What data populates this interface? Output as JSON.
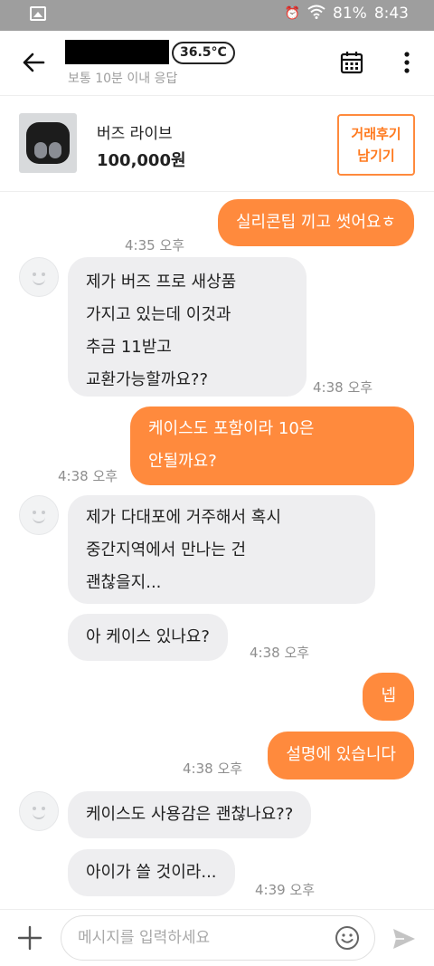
{
  "status_bar": {
    "battery": "81%",
    "time": "8:43"
  },
  "header": {
    "temperature": "36.5°C",
    "response_time": "보통 10분 이내 응답"
  },
  "product": {
    "name": "버즈 라이브",
    "price": "100,000원",
    "review_button": [
      "거래후기",
      "남기기"
    ]
  },
  "messages": [
    {
      "sender": "me",
      "lines": [
        "실리콘팁 끼고 썻어요ㅎ"
      ],
      "time": "4:35 오후"
    },
    {
      "sender": "them",
      "lines": [
        "제가 버즈 프로 새상품",
        "가지고 있는데 이것과",
        "추금 11받고",
        "교환가능할까요??"
      ],
      "time": "4:38 오후"
    },
    {
      "sender": "me",
      "lines": [
        "케이스도 포함이라 10은",
        "안될까요?"
      ],
      "time": "4:38 오후"
    },
    {
      "sender": "them",
      "lines": [
        "제가 다대포에 거주해서 혹시",
        "중간지역에서 만나는 건",
        "괜찮을지..."
      ],
      "time": ""
    },
    {
      "sender": "them",
      "lines": [
        "아 케이스 있나요?"
      ],
      "time": "4:38 오후"
    },
    {
      "sender": "me",
      "lines": [
        "넵"
      ],
      "time": ""
    },
    {
      "sender": "me",
      "lines": [
        "설명에 있습니다"
      ],
      "time": "4:38 오후"
    },
    {
      "sender": "them",
      "lines": [
        "케이스도 사용감은 괜찮나요??"
      ],
      "time": ""
    },
    {
      "sender": "them",
      "lines": [
        "아이가 쓸 것이라..."
      ],
      "time": "4:39 오후"
    }
  ],
  "input": {
    "placeholder": "메시지를 입력하세요"
  },
  "colors": {
    "accent": "#ff8a3d",
    "incoming_bubble": "#eeeef0"
  }
}
